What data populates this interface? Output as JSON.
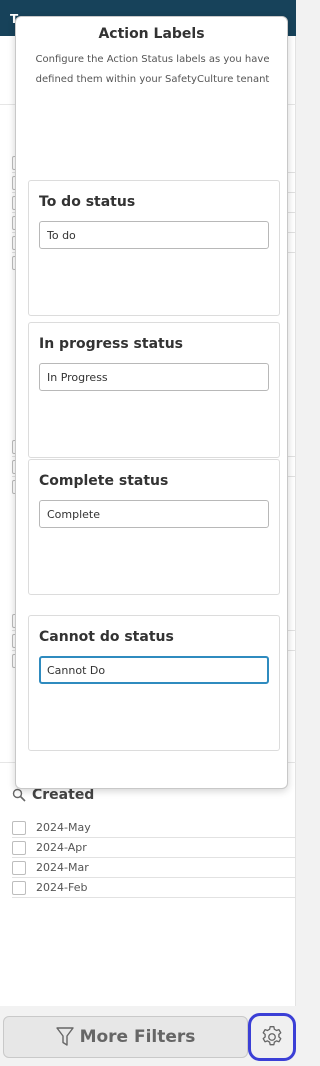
{
  "background": {
    "header_fragment": "T"
  },
  "popup": {
    "title": "Action Labels",
    "description": "Configure the Action Status labels as you have defined them within your SafetyCulture tenant",
    "fields": [
      {
        "label": "To do status",
        "value": "To do"
      },
      {
        "label": "In progress status",
        "value": "In Progress"
      },
      {
        "label": "Complete status",
        "value": "Complete"
      },
      {
        "label": "Cannot do status",
        "value": "Cannot Do"
      }
    ]
  },
  "created": {
    "title": "Created",
    "items": [
      "2024-May",
      "2024-Apr",
      "2024-Mar",
      "2024-Feb"
    ]
  },
  "footer": {
    "more_filters_label": "More Filters"
  },
  "icons": {
    "search": "magnifier-icon",
    "filter": "funnel-icon",
    "settings": "gear-icon"
  },
  "colors": {
    "header": "#17425a",
    "focus": "#2f8bbf",
    "gear_outline": "#3b3fd6"
  }
}
